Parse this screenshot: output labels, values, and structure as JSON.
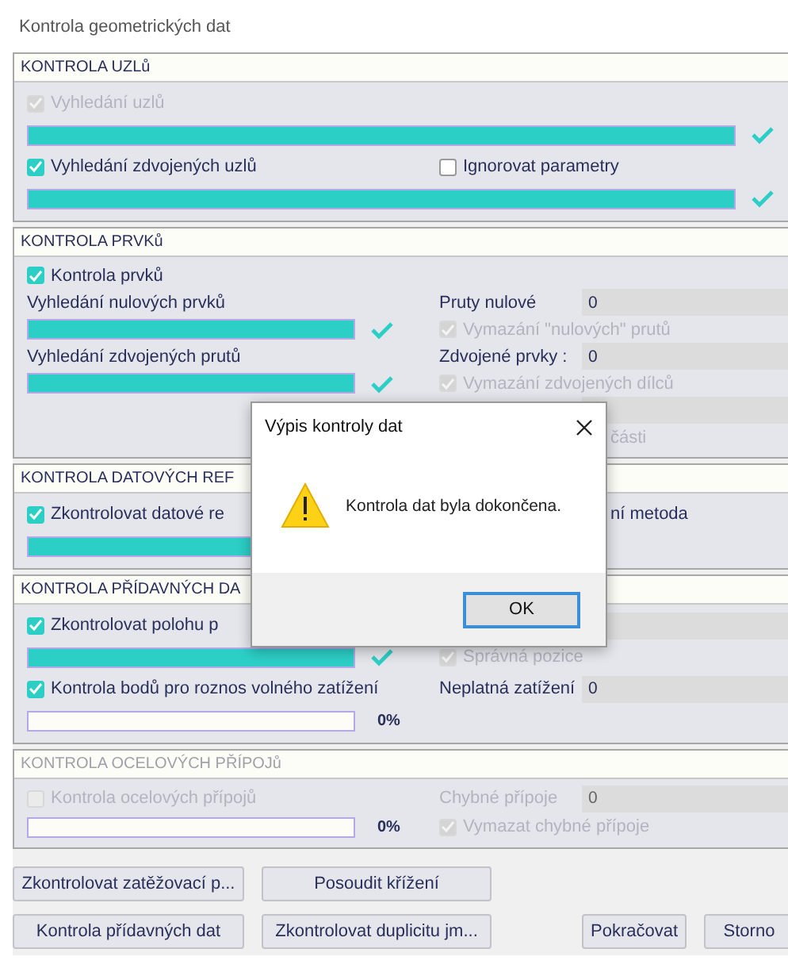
{
  "window": {
    "title": "Kontrola geometrických dat"
  },
  "sections": [
    {
      "title": "KONTROLA UZLů",
      "disabled": false,
      "rows": [
        {
          "left": {
            "kind": "checkbox",
            "label": "Vyhledání uzlů",
            "checked": true,
            "disabled": true
          }
        },
        {
          "left": {
            "kind": "widebar",
            "level": 1,
            "done": true
          }
        },
        {
          "left": {
            "kind": "checkbox",
            "label": "Vyhledání zdvojených uzlů",
            "checked": true,
            "disabled": false
          },
          "right": {
            "kind": "checkbox",
            "label": "Ignorovat parametry",
            "checked": false,
            "disabled": false
          }
        },
        {
          "left": {
            "kind": "widebar",
            "level": 1,
            "done": true
          }
        }
      ]
    },
    {
      "title": "KONTROLA PRVKů",
      "disabled": false,
      "rows": [
        {
          "left": {
            "kind": "checkbox",
            "label": "Kontrola prvků",
            "checked": true,
            "disabled": false
          }
        },
        {
          "left": {
            "kind": "label",
            "text": "Vyhledání nulových prvků"
          },
          "right": {
            "kind": "field",
            "label": "Pruty nulové",
            "value": "0"
          }
        },
        {
          "left": {
            "kind": "bar",
            "level": 1,
            "done": true
          },
          "right": {
            "kind": "checkbox",
            "label": "Vymazání \"nulových\" prutů",
            "checked": true,
            "disabled": true
          }
        },
        {
          "left": {
            "kind": "label",
            "text": "Vyhledání zdvojených prutů"
          },
          "right": {
            "kind": "field",
            "label": "Zdvojené prvky :",
            "value": "0"
          }
        },
        {
          "left": {
            "kind": "bar",
            "level": 1,
            "done": true
          },
          "right": {
            "kind": "checkbox",
            "label": "Vymazání zdvojených dílců",
            "checked": true,
            "disabled": true
          }
        },
        {
          "right": {
            "kind": "field"
          }
        },
        {
          "right": {
            "kind": "tail",
            "text": "části",
            "disabled": true
          }
        }
      ]
    },
    {
      "title": "KONTROLA DATOVÝCH REF",
      "disabled": false,
      "rows": [
        {
          "left": {
            "kind": "checkbox",
            "label": "Zkontrolovat datové re",
            "checked": true,
            "disabled": false
          },
          "right": {
            "kind": "tail",
            "text": "ní metoda",
            "disabled": false
          }
        },
        {
          "left": {
            "kind": "bar",
            "level": 1,
            "done": false
          }
        }
      ]
    },
    {
      "title": "KONTROLA PŘÍDAVNÝCH DA",
      "disabled": false,
      "rows": [
        {
          "left": {
            "kind": "checkbox",
            "label": "Zkontrolovat polohu p",
            "checked": true,
            "disabled": false
          },
          "right": {
            "kind": "field"
          }
        },
        {
          "left": {
            "kind": "bar",
            "level": 1,
            "done": true
          },
          "right": {
            "kind": "checkbox",
            "label": "Správná pozice",
            "checked": true,
            "disabled": true
          }
        },
        {
          "left": {
            "kind": "checkbox",
            "label": "Kontrola bodů pro roznos volného zatížení",
            "checked": true,
            "disabled": false
          },
          "right": {
            "kind": "field",
            "label": "Neplatná zatížení",
            "value": "0"
          }
        },
        {
          "left": {
            "kind": "bar",
            "level": 0,
            "done": false,
            "reading": "0%"
          }
        }
      ]
    },
    {
      "title": "KONTROLA OCELOVÝCH PŘÍPOJů",
      "disabled": true,
      "rows": [
        {
          "left": {
            "kind": "checkbox",
            "label": "Kontrola ocelových přípojů",
            "checked": false
          },
          "right": {
            "kind": "field",
            "label": "Chybné přípoje",
            "value": "0"
          }
        },
        {
          "left": {
            "kind": "bar",
            "level": 0,
            "done": false,
            "reading": "0%"
          },
          "right": {
            "kind": "checkbox",
            "label": "Vymazat chybné přípoje",
            "checked": true
          }
        }
      ]
    }
  ],
  "buttons": [
    [
      "Zkontrolovat zatěžovací p...",
      "Posoudit křížení"
    ],
    [
      "Kontrola přídavných dat",
      "Zkontrolovat duplicitu jm...",
      "Pokračovat",
      "Storno"
    ]
  ],
  "dialog": {
    "title": "Výpis kontroly dat",
    "message": "Kontrola dat byla dokončena.",
    "buttons": [
      "OK"
    ]
  }
}
